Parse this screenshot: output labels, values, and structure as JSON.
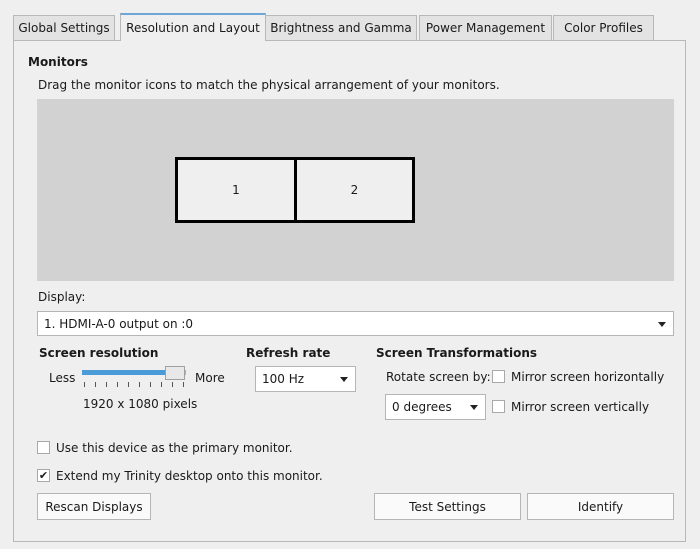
{
  "tabs": [
    {
      "label": "Global Settings"
    },
    {
      "label": "Resolution and Layout"
    },
    {
      "label": "Brightness and Gamma"
    },
    {
      "label": "Power Management"
    },
    {
      "label": "Color Profiles"
    }
  ],
  "monitors": {
    "heading": "Monitors",
    "instruction": "Drag the monitor icons to match the physical arrangement of your monitors.",
    "items": [
      {
        "label": "1"
      },
      {
        "label": "2"
      }
    ]
  },
  "display": {
    "label": "Display:",
    "selected": "1. HDMI-A-0 output on :0"
  },
  "resolution": {
    "heading": "Screen resolution",
    "less": "Less",
    "more": "More",
    "value": "1920 x 1080 pixels",
    "slider_fraction": 0.8
  },
  "refresh": {
    "heading": "Refresh rate",
    "selected": "100 Hz"
  },
  "transform": {
    "heading": "Screen Transformations",
    "rotate_label": "Rotate screen by:",
    "rotate_selected": "0 degrees",
    "mirror_h": "Mirror screen horizontally",
    "mirror_v": "Mirror screen vertically"
  },
  "options": {
    "primary": {
      "label": "Use this device as the primary monitor.",
      "checked": false
    },
    "extend": {
      "label": "Extend my Trinity desktop onto this monitor.",
      "checked": true
    }
  },
  "buttons": {
    "rescan": "Rescan Displays",
    "test": "Test Settings",
    "identify": "Identify"
  },
  "icons": {
    "check": "check-icon",
    "dropdown": "chevron-down-icon"
  },
  "colors": {
    "accent": "#6ea6d6",
    "slider_fill": "#4a9bd8"
  }
}
